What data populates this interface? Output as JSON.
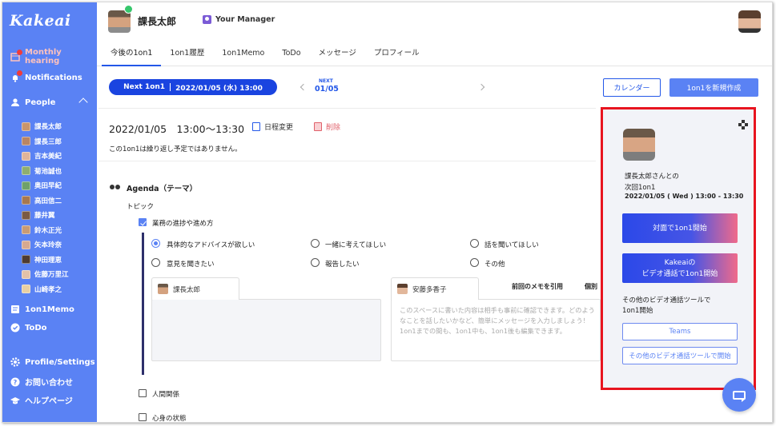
{
  "app": {
    "logo": "Kakeai"
  },
  "sidebar": {
    "monthly_hearing": "Monthly hearing",
    "notifications": "Notifications",
    "people": "People",
    "people_list": [
      "課長太郎",
      "課長三郎",
      "吉本美紀",
      "菊池誠也",
      "奥田早紀",
      "高田信二",
      "藤井翼",
      "鈴木正光",
      "矢本玲奈",
      "神田理恵",
      "佐藤万里江",
      "山崎孝之"
    ],
    "memo": "1on1Memo",
    "todo": "ToDo",
    "profile": "Profile/Settings",
    "contact": "お問い合わせ",
    "help": "ヘルプページ"
  },
  "header": {
    "name": "課長太郎",
    "manager_label": "Your Manager"
  },
  "tabs": [
    "今後の1on1",
    "1on1履歴",
    "1on1Memo",
    "ToDo",
    "メッセージ",
    "プロフィール"
  ],
  "next_bar": {
    "pill_label": "Next 1on1",
    "pill_date": "2022/01/05 (水) 13:00",
    "nav_label": "NEXT",
    "nav_value": "01/05",
    "calendar_button": "カレンダー",
    "new_button": "1on1を新規作成"
  },
  "meeting": {
    "datetime": "2022/01/05　13:00〜13:30",
    "reschedule": "日程変更",
    "delete": "削除",
    "repeat_note": "この1on1は繰り返し予定ではありません。"
  },
  "agenda": {
    "title": "Agenda（テーマ）",
    "topic_label": "トピック",
    "topics": [
      "業務の進捗や進め方",
      "人間関係",
      "心身の状態"
    ],
    "options": [
      "具体的なアドバイスが欲しい",
      "一緒に考えてほしい",
      "話を聞いてほしい",
      "意見を聞きたい",
      "報告したい",
      "その他"
    ],
    "memo_tab_left": "課長太郎",
    "memo_tab_right": "安藤多香子",
    "prev_memo_link": "前回のメモを引用",
    "private_link": "個別",
    "memo_placeholder": "このスペースに書いた内容は相手も事前に確認できます。どのようなことを話したいかなど、簡単にメッセージを入力しましょう！1on1までの間も、1on1中も、1on1後も編集できます。"
  },
  "panel": {
    "line1": "課長太郎さんとの",
    "line2": "次回1on1",
    "line3": "2022/01/05 ( Wed ) 13:00 - 13:30",
    "btn_face": "対面で1on1開始",
    "btn_video_1": "Kakeaiの",
    "btn_video_2": "ビデオ通話で1on1開始",
    "other_1": "その他のビデオ通話ツールで",
    "other_2": "1on1開始",
    "teams": "Teams",
    "other_tool": "その他のビデオ通話ツールで開始"
  }
}
